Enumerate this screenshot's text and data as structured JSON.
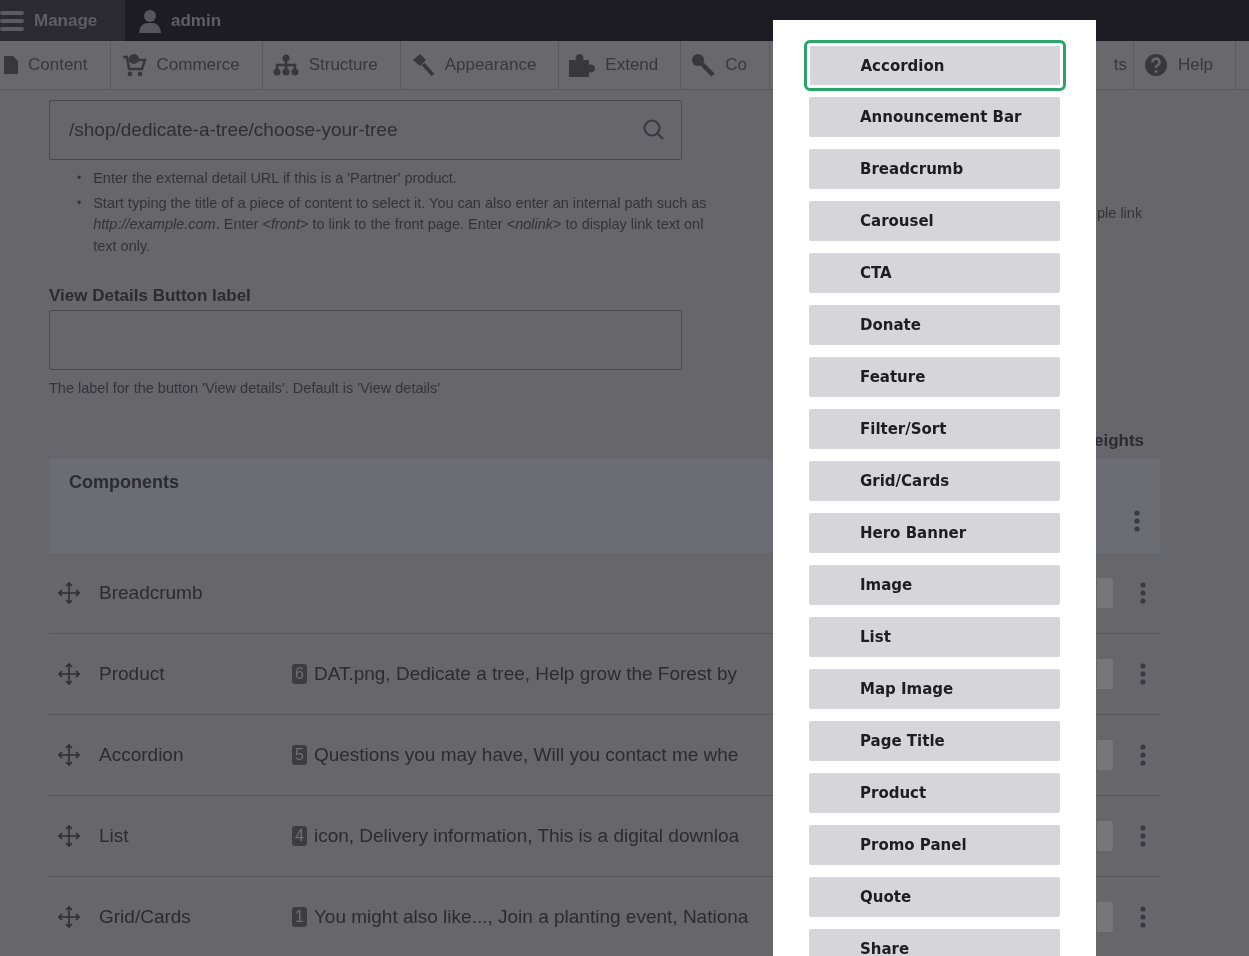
{
  "toolbar": {
    "manage": "Manage",
    "user": "admin"
  },
  "tabs": [
    {
      "label": "Content"
    },
    {
      "label": "Commerce"
    },
    {
      "label": "Structure"
    },
    {
      "label": "Appearance"
    },
    {
      "label": "Extend"
    },
    {
      "label": "Co"
    },
    {
      "label": "ts"
    },
    {
      "label": "Help"
    }
  ],
  "url_field": {
    "value": "/shop/dedicate-a-tree/choose-your-tree"
  },
  "url_help": [
    {
      "bullet": "•",
      "lines": [
        "Enter the external detail URL if this is a 'Partner' product."
      ]
    },
    {
      "bullet": "•",
      "lines": [
        "Start typing the title of a piece of content to select it. You can also enter an internal path such as",
        "*http://example.com*. Enter <*front*> to link to the front page. Enter <*nolink*> to display link text onl",
        "text only."
      ]
    }
  ],
  "url_help_overflow": "ple link",
  "view_details": {
    "label": "View Details Button label",
    "description": "The label for the button 'View details'. Default is 'View details'"
  },
  "weights_fragment": "eights",
  "components": {
    "title": "Components",
    "rows": [
      {
        "label": "Breadcrumb"
      },
      {
        "label": "Product",
        "count": "6",
        "summary": "DAT.png, Dedicate a tree, Help grow the Forest by"
      },
      {
        "label": "Accordion",
        "count": "5",
        "summary": "Questions you may have, Will you contact me whe"
      },
      {
        "label": "List",
        "count": "4",
        "summary": "icon, Delivery information, This is a digital downloa"
      },
      {
        "label": "Grid/Cards",
        "count": "1",
        "summary": "You might also like..., Join a planting event, Nationa"
      }
    ]
  },
  "dialog": {
    "buttons": [
      {
        "label": "Accordion",
        "selected": true
      },
      {
        "label": "Announcement Bar",
        "selected": false
      },
      {
        "label": "Breadcrumb",
        "selected": false
      },
      {
        "label": "Carousel",
        "selected": false
      },
      {
        "label": "CTA",
        "selected": false
      },
      {
        "label": "Donate",
        "selected": false
      },
      {
        "label": "Feature",
        "selected": false
      },
      {
        "label": "Filter/Sort",
        "selected": false
      },
      {
        "label": "Grid/Cards",
        "selected": false
      },
      {
        "label": "Hero Banner",
        "selected": false
      },
      {
        "label": "Image",
        "selected": false
      },
      {
        "label": "List",
        "selected": false
      },
      {
        "label": "Map Image",
        "selected": false
      },
      {
        "label": "Page Title",
        "selected": false
      },
      {
        "label": "Product",
        "selected": false
      },
      {
        "label": "Promo Panel",
        "selected": false
      },
      {
        "label": "Quote",
        "selected": false
      },
      {
        "label": "Share",
        "selected": false
      }
    ]
  }
}
